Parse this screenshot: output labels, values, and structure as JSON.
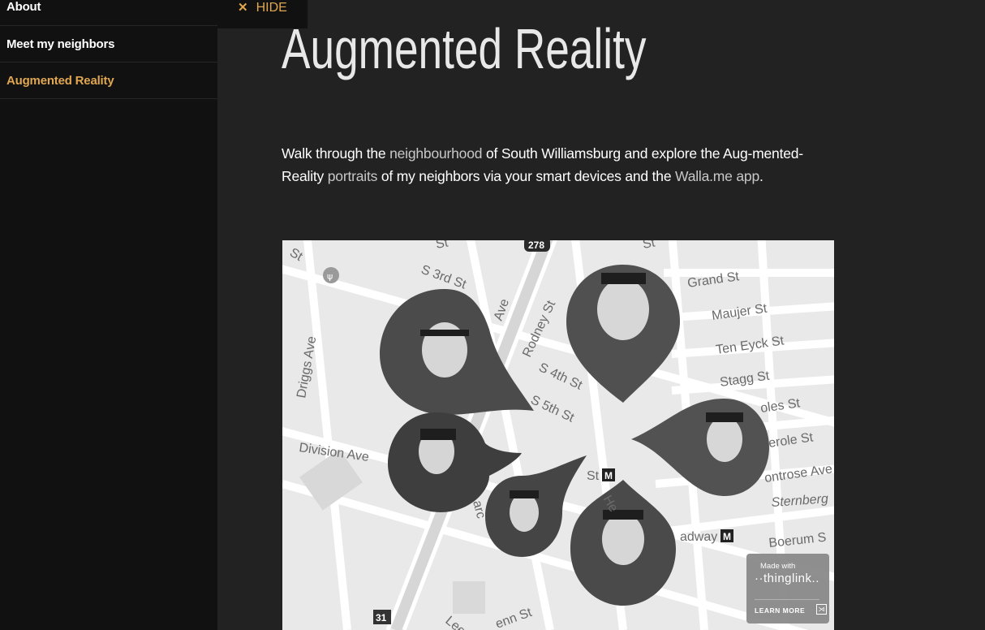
{
  "sidebar": {
    "items": [
      {
        "label": "About",
        "active": false
      },
      {
        "label": "Meet my neighbors",
        "active": false
      },
      {
        "label": "Augmented Reality",
        "active": true
      }
    ],
    "hide_label": "HIDE",
    "hide_icon": "close-icon"
  },
  "main": {
    "title": "Augmented Reality",
    "intro": {
      "t1": "Walk through the ",
      "link1": "neighbourhood",
      "t2": " of South Williamsburg and explore the Aug-mented-Reality ",
      "link2": "portraits",
      "t3": " of my neighbors via your smart devices and the ",
      "link3": "Walla.me",
      "t4": " ",
      "link4": "app",
      "t5": "."
    }
  },
  "map": {
    "labels": {
      "s3rd": "S 3rd St",
      "rodney": "Rodney St",
      "s4th": "S 4th St",
      "s5th": "S 5th St",
      "driggs": "Driggs Ave",
      "division": "Division Ave",
      "grand": "Grand St",
      "maujer": "Maujer St",
      "teneyck": "Ten Eyck St",
      "stagg": "Stagg St",
      "scholes": "oles St",
      "meserole": "erole St",
      "montrose": "ontrose Ave",
      "sternberg": "Sternberg",
      "broadway": "adway",
      "boerum": "Boerum S",
      "rt278": "278",
      "rt31": "31",
      "ave": "Ave",
      "st1": "St",
      "st2": "St",
      "st3": "St",
      "st4": "St",
      "st5": "St",
      "lee": "Lee",
      "penn": "enn St",
      "he": "He",
      "marcy": "arc",
      "m": "M"
    },
    "badge": {
      "made_with": "Made with",
      "brand": "··thinglink..",
      "learn_more": "LEARN MORE"
    }
  },
  "colors": {
    "accent": "#e0a750",
    "sidebar_bg": "#111111",
    "page_bg": "#222222"
  }
}
